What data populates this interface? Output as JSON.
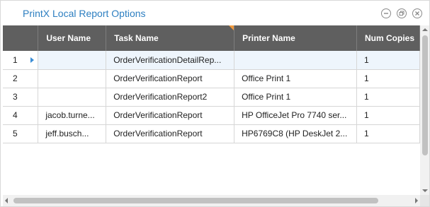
{
  "window": {
    "title": "PrintX Local Report Options",
    "controls": [
      "minimize-icon",
      "restore-icon",
      "close-icon"
    ],
    "accent_color": "#2d7fc1"
  },
  "grid": {
    "columns": [
      "",
      "User Name",
      "Task Name",
      "Printer Name",
      "Num Copies"
    ],
    "rows": [
      {
        "num": "1",
        "user": "",
        "task": "OrderVerificationDetailRep...",
        "printer": "",
        "copies": "1",
        "current": true
      },
      {
        "num": "2",
        "user": "",
        "task": "OrderVerificationReport",
        "printer": "Office Print 1",
        "copies": "1",
        "current": false
      },
      {
        "num": "3",
        "user": "",
        "task": "OrderVerificationReport2",
        "printer": "Office Print 1",
        "copies": "1",
        "current": false
      },
      {
        "num": "4",
        "user": "jacob.turne...",
        "task": "OrderVerificationReport",
        "printer": "HP OfficeJet Pro 7740 ser...",
        "copies": "1",
        "current": false
      },
      {
        "num": "5",
        "user": "jeff.busch...",
        "task": "OrderVerificationReport",
        "printer": "HP6769C8 (HP DeskJet 2...",
        "copies": "1",
        "current": false
      }
    ],
    "header_color": "#5f5f5f",
    "sort_marker_color": "#f19a3e"
  }
}
